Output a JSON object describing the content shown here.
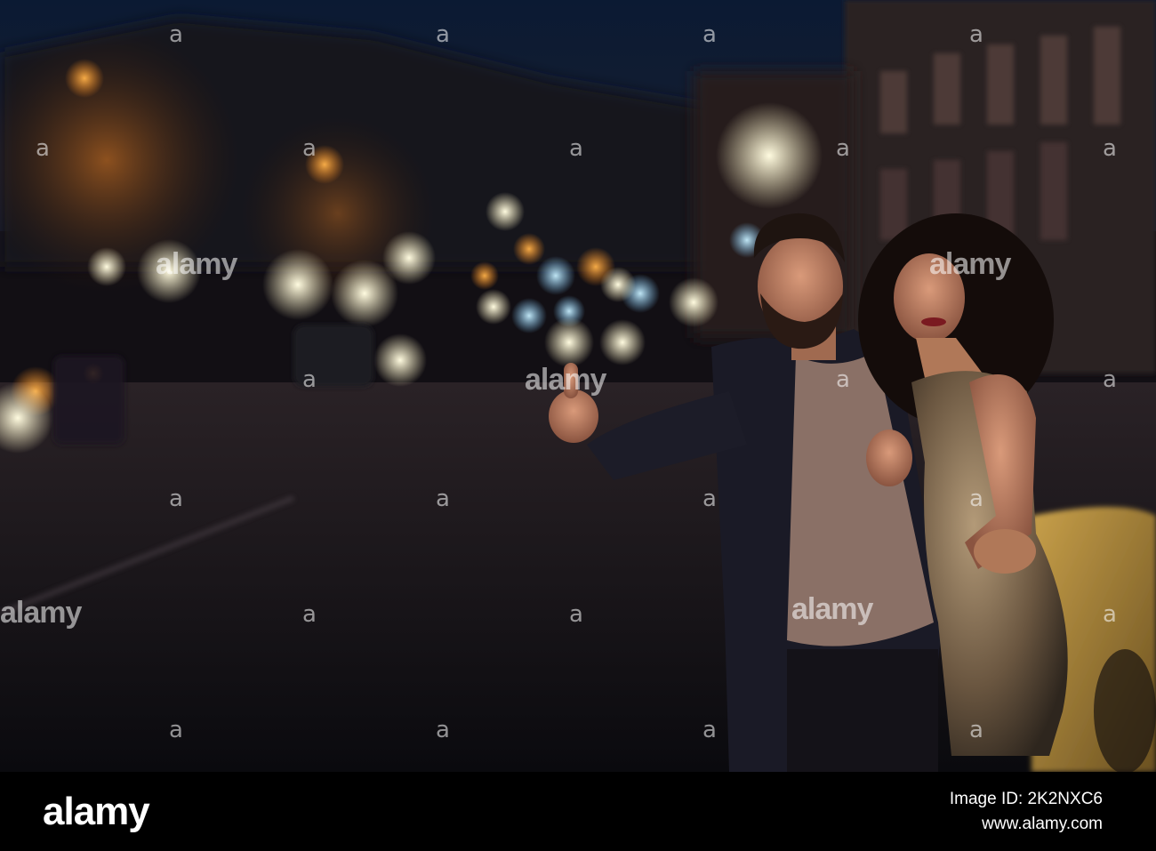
{
  "photo": {
    "description_icon": "photo-icon"
  },
  "watermark": {
    "brand": "alamy",
    "small_mark": "a"
  },
  "footer": {
    "logo": "alamy",
    "image_id": "Image ID: 2K2NXC6",
    "url": "www.alamy.com"
  }
}
